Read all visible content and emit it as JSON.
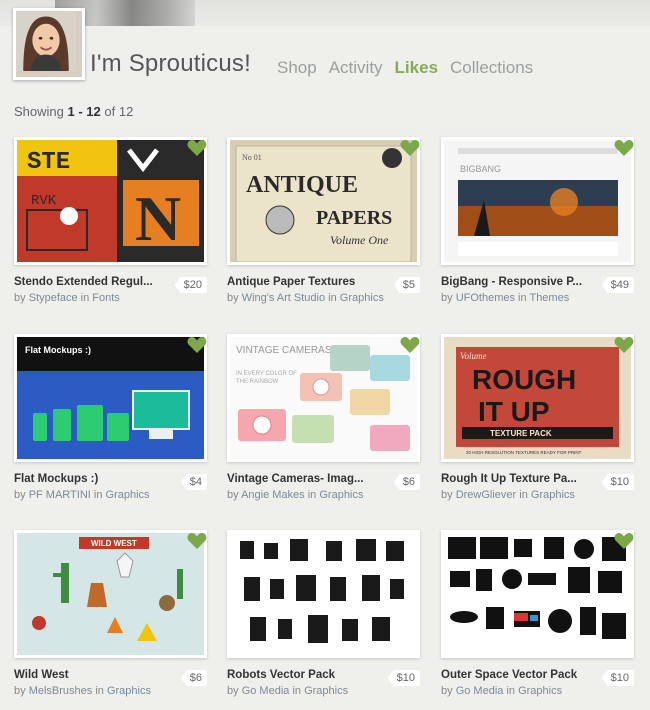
{
  "profile": {
    "name": "I'm Sprouticus!"
  },
  "nav": [
    {
      "label": "Shop",
      "active": false
    },
    {
      "label": "Activity",
      "active": false
    },
    {
      "label": "Likes",
      "active": true
    },
    {
      "label": "Collections",
      "active": false
    }
  ],
  "showing": {
    "prefix": "Showing",
    "range": "1 - 12",
    "of": "of",
    "total": "12"
  },
  "colors": {
    "accent_green": "#8aaa55",
    "heart_green": "#7da84a"
  },
  "products": [
    {
      "title": "Stendo Extended Regul...",
      "author": "Stypeface",
      "category": "Fonts",
      "price": "$20"
    },
    {
      "title": "Antique Paper Textures",
      "author": "Wing's Art Studio",
      "category": "Graphics",
      "price": "$5"
    },
    {
      "title": "BigBang - Responsive P...",
      "author": "UFOthemes",
      "category": "Themes",
      "price": "$49"
    },
    {
      "title": "Flat Mockups :)",
      "author": "PF MARTINI",
      "category": "Graphics",
      "price": "$4"
    },
    {
      "title": "Vintage Cameras- Imag...",
      "author": "Angie Makes",
      "category": "Graphics",
      "price": "$6"
    },
    {
      "title": "Rough It Up Texture Pa...",
      "author": "DrewGliever",
      "category": "Graphics",
      "price": "$10"
    },
    {
      "title": "Wild West",
      "author": "MelsBrushes",
      "category": "Graphics",
      "price": "$6"
    },
    {
      "title": "Robots Vector Pack",
      "author": "Go Media",
      "category": "Graphics",
      "price": "$10"
    },
    {
      "title": "Outer Space Vector Pack",
      "author": "Go Media",
      "category": "Graphics",
      "price": "$10"
    }
  ],
  "by_word": "by",
  "in_word": "in",
  "thumb_text": {
    "stendo": [
      "STE",
      "RVK",
      "N"
    ],
    "antique": [
      "ANTIQUE",
      "PAPERS",
      "Volume One",
      "No 01"
    ],
    "bigbang": "BIGBANG",
    "flat": "Flat Mockups :)",
    "cameras": [
      "VINTAGE CAMERAS",
      "IN EVERY COLOR OF",
      "THE RAINBOW"
    ],
    "rough": [
      "Volume",
      "ROUGH",
      "IT UP",
      "TEXTURE PACK",
      "20 HIGH RESOLUTION TEXTURES READY FOR PRINT"
    ],
    "wildwest": "WILD WEST"
  }
}
